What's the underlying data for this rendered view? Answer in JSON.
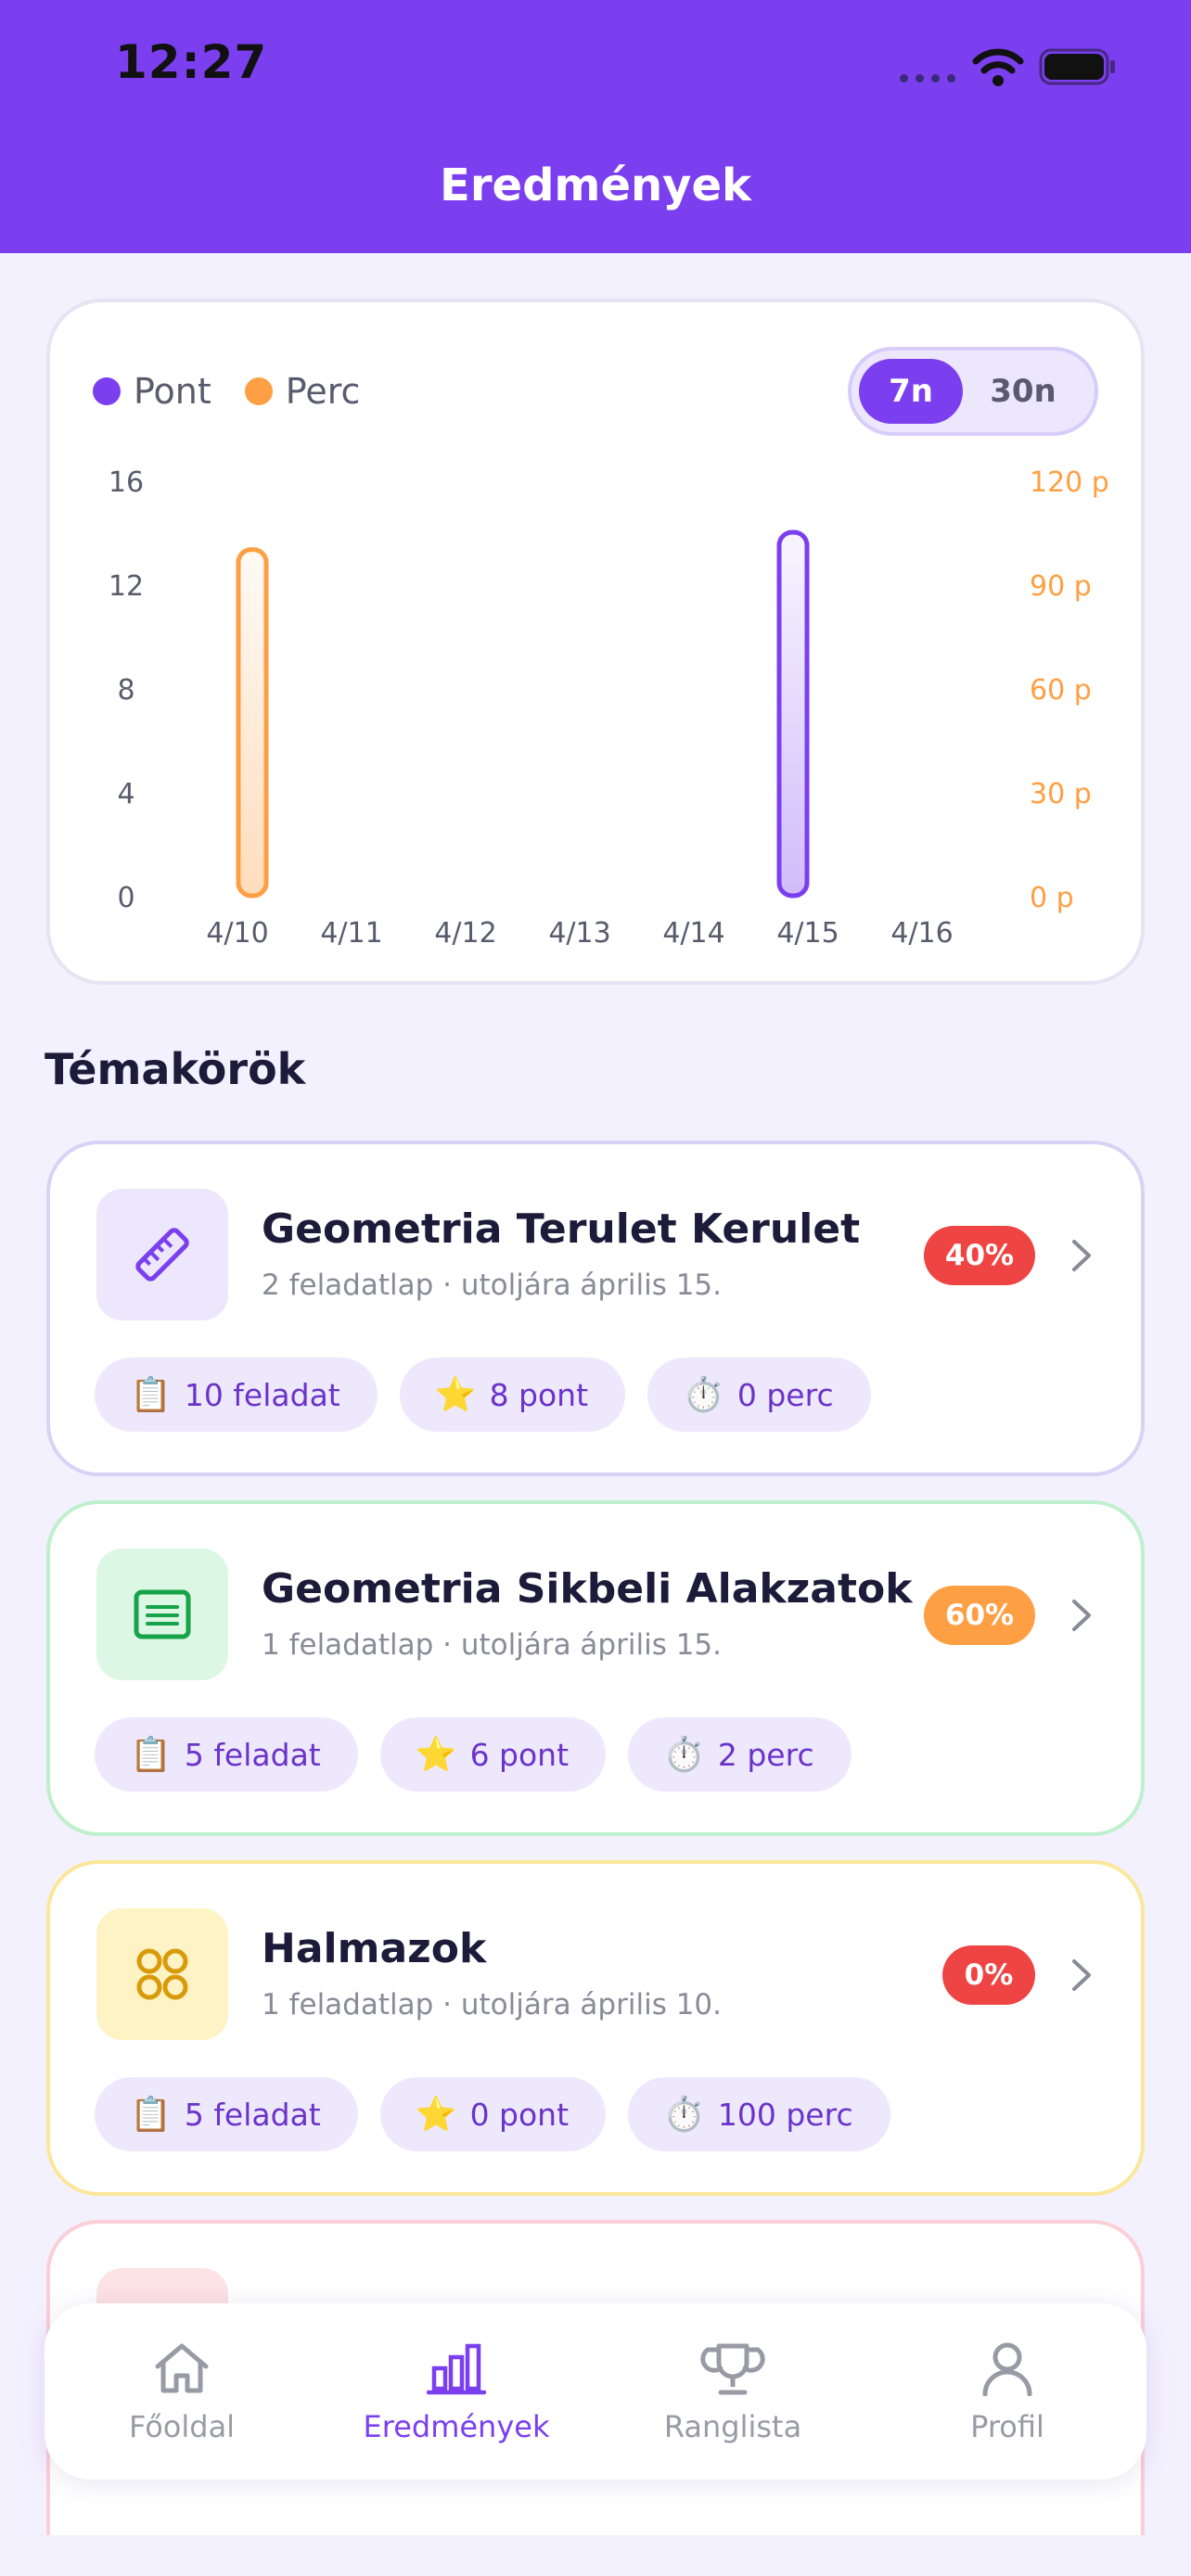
{
  "status_bar": {
    "time": "12:27"
  },
  "header": {
    "title": "Eredmények"
  },
  "chart": {
    "legend": [
      {
        "label": "Pont",
        "color": "#7b3ff0"
      },
      {
        "label": "Perc",
        "color": "#ff9f43"
      }
    ],
    "range_options": [
      {
        "label": "7n",
        "selected": true
      },
      {
        "label": "30n",
        "selected": false
      }
    ]
  },
  "chart_data": {
    "type": "bar",
    "categories": [
      "4/10",
      "4/11",
      "4/12",
      "4/13",
      "4/14",
      "4/15",
      "4/16"
    ],
    "series": [
      {
        "name": "Pont",
        "axis": "left",
        "color": "#7b3ff0",
        "values": [
          0,
          0,
          0,
          0,
          0,
          14,
          0
        ]
      },
      {
        "name": "Perc",
        "axis": "right",
        "color": "#ff9f43",
        "values": [
          100,
          0,
          0,
          0,
          0,
          0,
          0
        ]
      }
    ],
    "y_left": {
      "ticks": [
        "0",
        "4",
        "8",
        "12",
        "16"
      ],
      "range": [
        0,
        16
      ]
    },
    "y_right": {
      "ticks": [
        "0 p",
        "30 p",
        "60 p",
        "90 p",
        "120 p"
      ],
      "range": [
        0,
        120
      ]
    }
  },
  "topics_section": {
    "title": "Témakörök"
  },
  "topics": [
    {
      "title": "Geometria Terulet Kerulet",
      "subtitle": "2 feladatlap · utoljára április 15.",
      "percent": "40%",
      "badge_color": "#ef4444",
      "border_color": "#d8d2f7",
      "icon": "ruler-icon",
      "icon_bg": "#ece7fd",
      "icon_color": "#7b3ff0",
      "chips": [
        {
          "emoji": "📋",
          "text": "10 feladat"
        },
        {
          "emoji": "⭐",
          "text": "8 pont"
        },
        {
          "emoji": "⏱️",
          "text": "0 perc"
        }
      ]
    },
    {
      "title": "Geometria Sikbeli Alakzatok",
      "subtitle": "1 feladatlap · utoljára április 15.",
      "percent": "60%",
      "badge_color": "#ff9f43",
      "border_color": "#bff0cd",
      "icon": "list-document-icon",
      "icon_bg": "#dcf8e4",
      "icon_color": "#16a34a",
      "chips": [
        {
          "emoji": "📋",
          "text": "5 feladat"
        },
        {
          "emoji": "⭐",
          "text": "6 pont"
        },
        {
          "emoji": "⏱️",
          "text": "2 perc"
        }
      ]
    },
    {
      "title": "Halmazok",
      "subtitle": "1 feladatlap · utoljára április 10.",
      "percent": "0%",
      "badge_color": "#ef4444",
      "border_color": "#fbe79a",
      "icon": "circles-grid-icon",
      "icon_bg": "#fdf3c4",
      "icon_color": "#d99a0a",
      "chips": [
        {
          "emoji": "📋",
          "text": "5 feladat"
        },
        {
          "emoji": "⭐",
          "text": "0 pont"
        },
        {
          "emoji": "⏱️",
          "text": "100 perc"
        }
      ]
    }
  ],
  "tab_bar": [
    {
      "label": "Főoldal",
      "icon": "home-icon",
      "active": false
    },
    {
      "label": "Eredmények",
      "icon": "bar-chart-icon",
      "active": true
    },
    {
      "label": "Ranglista",
      "icon": "trophy-icon",
      "active": false
    },
    {
      "label": "Profil",
      "icon": "profile-icon",
      "active": false
    }
  ]
}
